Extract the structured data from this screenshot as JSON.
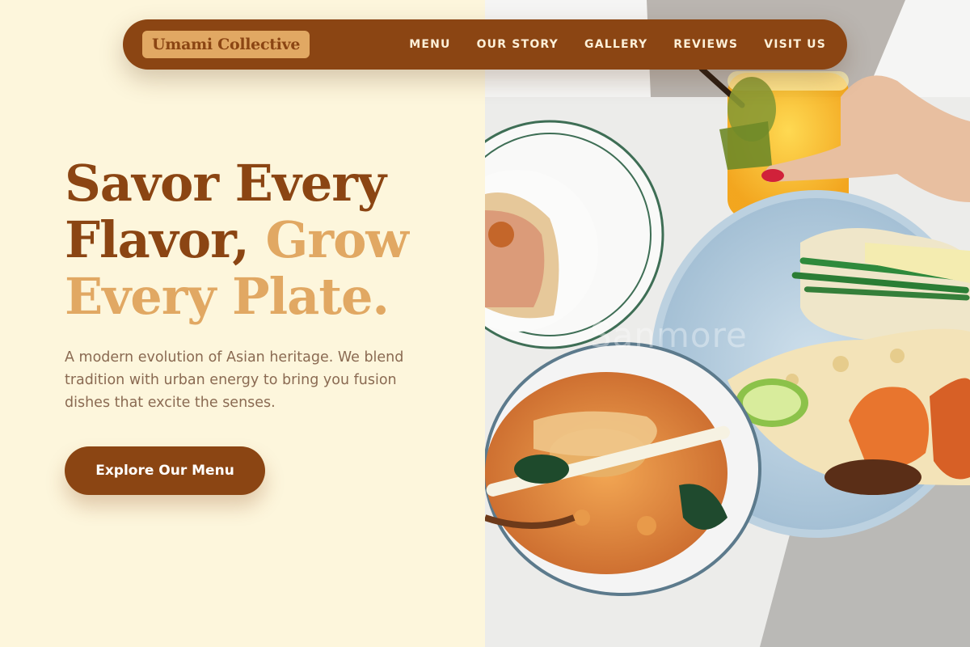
{
  "brand": {
    "name": "Umami Collective"
  },
  "nav": {
    "items": [
      "MENU",
      "OUR STORY",
      "GALLERY",
      "REVIEWS",
      "VISIT US"
    ]
  },
  "hero": {
    "title_part1": "Savor Every Flavor,",
    "title_part2": "Grow Every Plate.",
    "description": "A modern evolution of Asian heritage. We blend tradition with urban energy to bring you fusion dishes that excite the senses.",
    "cta_label": "Explore Our Menu"
  },
  "photo": {
    "watermark": "Sanmore"
  },
  "colors": {
    "background": "#fdf6dc",
    "primary": "#8b4513",
    "accent": "#e1a863",
    "text_muted": "#8a6a52"
  },
  "icons": []
}
